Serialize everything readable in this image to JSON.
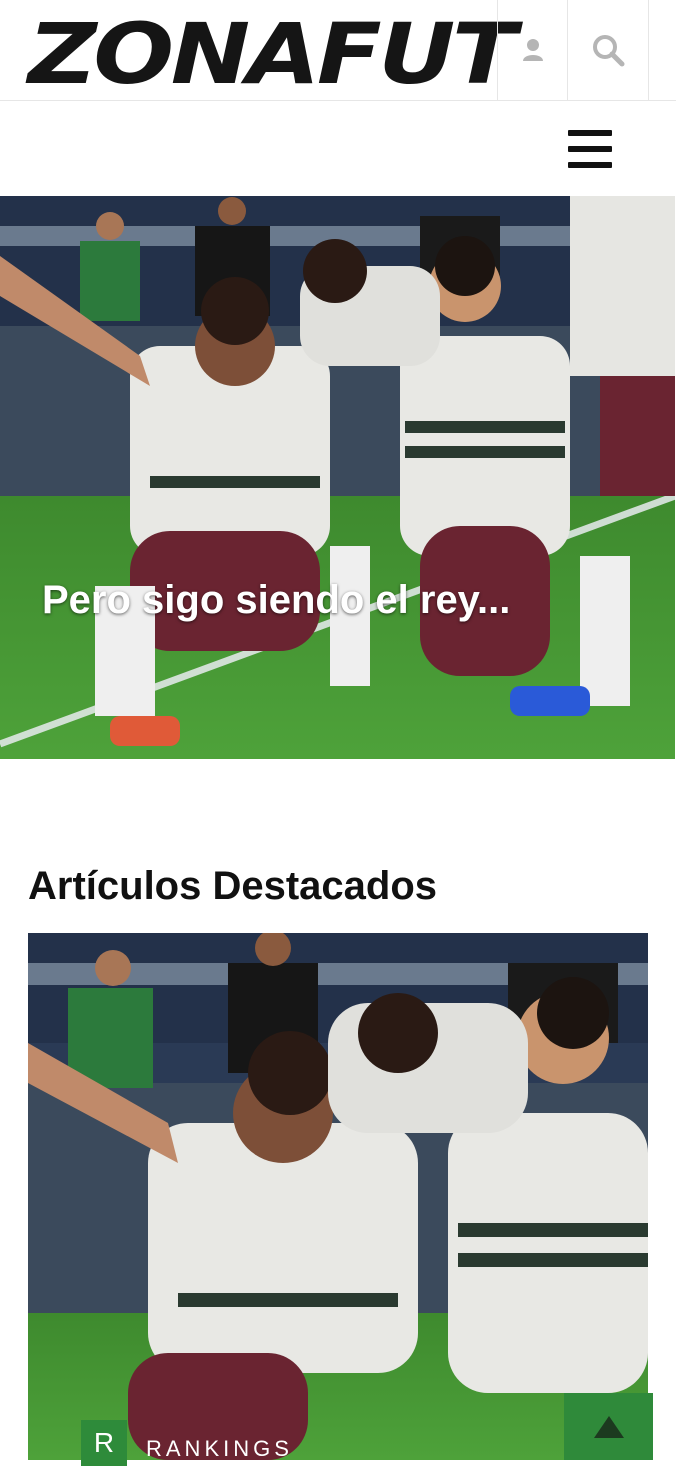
{
  "header": {
    "logo_text": "ZONAFUT",
    "icons": [
      "user-icon",
      "search-icon",
      "menu-icon"
    ]
  },
  "hero": {
    "title": "Pero sigo siendo el rey..."
  },
  "featured": {
    "heading": "Artículos Destacados",
    "card": {
      "badge_letter": "R",
      "category": "RANKINGS"
    }
  },
  "colors": {
    "accent_green": "#2e8b3a",
    "text_dark": "#111111",
    "icon_grey": "#b5b5b5"
  }
}
